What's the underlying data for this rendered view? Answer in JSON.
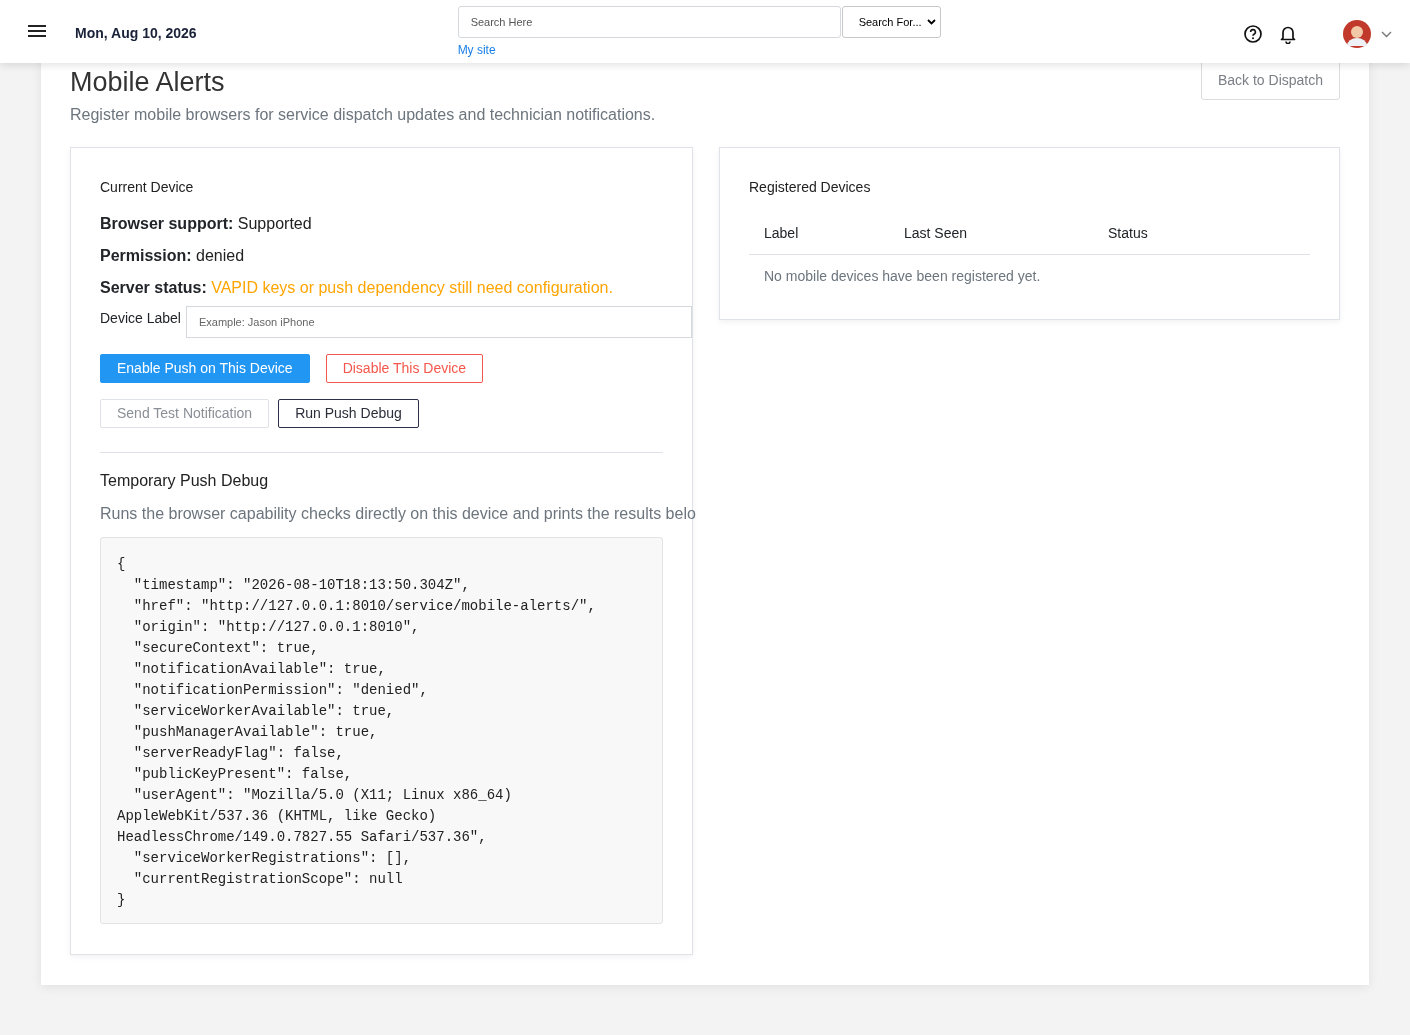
{
  "header": {
    "date": "Mon, Aug 10, 2026",
    "search": {
      "placeholder": "Search Here"
    },
    "search_scope": "Search For...",
    "site_link": "My site"
  },
  "page": {
    "title": "Mobile Alerts",
    "subtitle": "Register mobile browsers for service dispatch updates and technician notifications.",
    "back_button": "Back to Dispatch"
  },
  "current_device": {
    "title": "Current Device",
    "facts": [
      {
        "label": "Browser support:",
        "value": "Supported",
        "kind": "plain"
      },
      {
        "label": "Permission:",
        "value": "denied",
        "kind": "plain"
      },
      {
        "label": "Server status:",
        "value": "VAPID keys or push dependency still need configuration.",
        "kind": "warning"
      }
    ],
    "device_label": {
      "label": "Device Label",
      "placeholder": "Example: Jason iPhone"
    },
    "buttons": [
      {
        "label": "Enable Push on This Device",
        "kind": "primary",
        "disabled": false
      },
      {
        "label": "Disable This Device",
        "kind": "danger",
        "disabled": false
      },
      {
        "label": "Send Test Notification",
        "kind": "outline",
        "disabled": true
      },
      {
        "label": "Run Push Debug",
        "kind": "outline",
        "disabled": false
      }
    ],
    "debug": {
      "title": "Temporary Push Debug",
      "description": "Runs the browser capability checks directly on this device and prints the results belo",
      "output": "{\n  \"timestamp\": \"2026-08-10T18:13:50.304Z\",\n  \"href\": \"http://127.0.0.1:8010/service/mobile-alerts/\",\n  \"origin\": \"http://127.0.0.1:8010\",\n  \"secureContext\": true,\n  \"notificationAvailable\": true,\n  \"notificationPermission\": \"denied\",\n  \"serviceWorkerAvailable\": true,\n  \"pushManagerAvailable\": true,\n  \"serverReadyFlag\": false,\n  \"publicKeyPresent\": false,\n  \"userAgent\": \"Mozilla/5.0 (X11; Linux x86_64)\nAppleWebKit/537.36 (KHTML, like Gecko)\nHeadlessChrome/149.0.7827.55 Safari/537.36\",\n  \"serviceWorkerRegistrations\": [],\n  \"currentRegistrationScope\": null\n}"
    }
  },
  "registered_devices": {
    "title": "Registered Devices",
    "columns": [
      "Label",
      "Last Seen",
      "Status"
    ],
    "empty_message": "No mobile devices have been registered yet."
  }
}
